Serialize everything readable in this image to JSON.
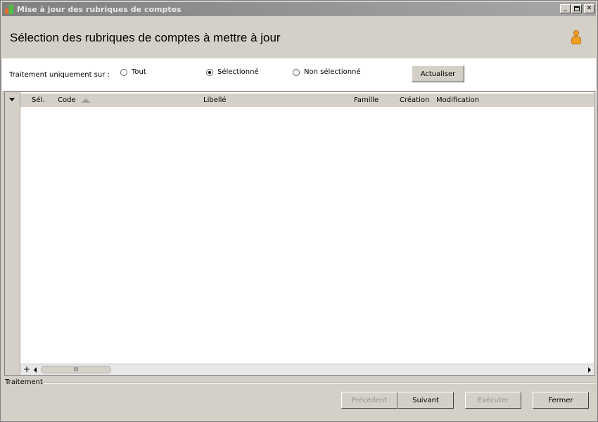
{
  "window": {
    "title": "Mise à jour des rubriques de comptes"
  },
  "header": {
    "title": "Sélection des rubriques de comptes à mettre à jour"
  },
  "filter": {
    "label": "Traitement uniquement sur :",
    "options": [
      {
        "label": "Tout",
        "checked": false
      },
      {
        "label": "Sélectionné",
        "checked": true
      },
      {
        "label": "Non sélectionné",
        "checked": false
      }
    ],
    "refresh_label": "Actualiser"
  },
  "grid": {
    "columns": [
      "Sél.",
      "Code",
      "Libellé",
      "Famille",
      "Création",
      "Modification"
    ],
    "sort_column": "Code",
    "sort_direction": "asc",
    "rows": [],
    "scroll_thumb": "III"
  },
  "section": {
    "label": "Traitement"
  },
  "footer": {
    "prev_label": "Précédent",
    "next_label": "Suivant",
    "exec_label": "Exécuter",
    "close_label": "Fermer"
  }
}
